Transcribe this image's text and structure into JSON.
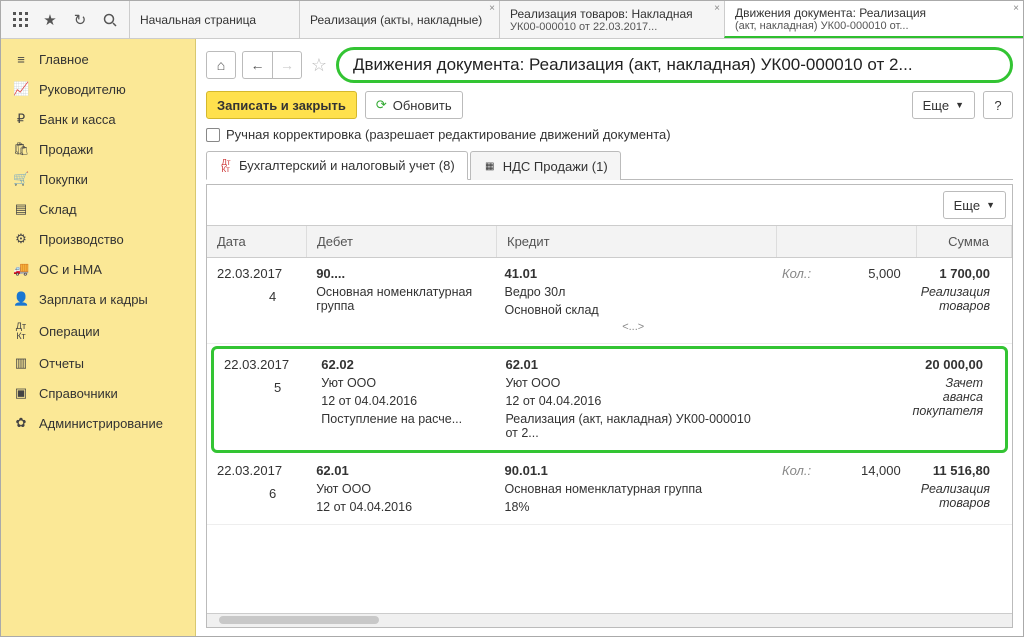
{
  "topIcons": [
    "grid",
    "star",
    "cube",
    "search"
  ],
  "tabs": [
    {
      "line1": "Начальная страница",
      "line2": ""
    },
    {
      "line1": "Реализация (акты, накладные)",
      "line2": ""
    },
    {
      "line1": "Реализация товаров: Накладная",
      "line2": "УК00-000010 от 22.03.2017..."
    },
    {
      "line1": "Движения документа: Реализация",
      "line2": "(акт, накладная) УК00-000010 от..."
    }
  ],
  "sidebar": [
    {
      "icon": "≡",
      "label": "Главное"
    },
    {
      "icon": "📈",
      "label": "Руководителю"
    },
    {
      "icon": "₽",
      "label": "Банк и касса"
    },
    {
      "icon": "🛍",
      "label": "Продажи"
    },
    {
      "icon": "🛒",
      "label": "Покупки"
    },
    {
      "icon": "▤",
      "label": "Склад"
    },
    {
      "icon": "⚙",
      "label": "Производство"
    },
    {
      "icon": "🚚",
      "label": "ОС и НМА"
    },
    {
      "icon": "👤",
      "label": "Зарплата и кадры"
    },
    {
      "icon": "Дт",
      "label": "Операции"
    },
    {
      "icon": "▥",
      "label": "Отчеты"
    },
    {
      "icon": "▣",
      "label": "Справочники"
    },
    {
      "icon": "✿",
      "label": "Администрирование"
    }
  ],
  "title": "Движения документа: Реализация (акт, накладная) УК00-000010 от 2...",
  "buttons": {
    "save": "Записать и закрыть",
    "refresh": "Обновить",
    "more": "Еще",
    "help": "?"
  },
  "checkbox": "Ручная корректировка (разрешает редактирование движений документа)",
  "innerTabs": [
    "Бухгалтерский и налоговый учет (8)",
    "НДС Продажи (1)"
  ],
  "columns": {
    "date": "Дата",
    "debit": "Дебет",
    "credit": "Кредит",
    "sum": "Сумма"
  },
  "qtyLabel": "Кол.:",
  "entries": [
    {
      "date": "22.03.2017",
      "n": "4",
      "debAcct": "90....",
      "debL1": "Основная номенклатурная группа",
      "debL2": "",
      "creAcct": "41.01",
      "creL1": "Ведро 30л",
      "creL2": "Основной склад",
      "ell": "<...>",
      "qty": "5,000",
      "sum": "1 700,00",
      "note": "Реализация товаров",
      "hl": false
    },
    {
      "date": "22.03.2017",
      "n": "5",
      "debAcct": "62.02",
      "debL1": "Уют ООО",
      "debL2": "12 от 04.04.2016",
      "debL3": "Поступление на расче...",
      "creAcct": "62.01",
      "creL1": "Уют ООО",
      "creL2": "12 от 04.04.2016",
      "creL3": "Реализация (акт, накладная) УК00-000010 от 2...",
      "qty": "",
      "sum": "20 000,00",
      "note": "Зачет аванса покупателя",
      "hl": true
    },
    {
      "date": "22.03.2017",
      "n": "6",
      "debAcct": "62.01",
      "debL1": "Уют ООО",
      "debL2": "12 от 04.04.2016",
      "creAcct": "90.01.1",
      "creL1": "Основная номенклатурная группа",
      "creL2": "18%",
      "qty": "14,000",
      "sum": "11 516,80",
      "note": "Реализация товаров",
      "hl": false
    }
  ]
}
